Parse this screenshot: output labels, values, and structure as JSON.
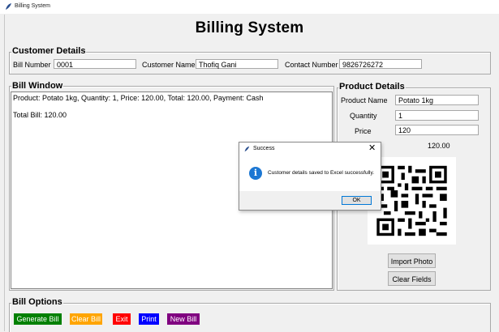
{
  "window": {
    "title": "Billing System"
  },
  "app_title": "Billing System",
  "customer_details": {
    "legend": "Customer Details",
    "bill_number_label": "Bill Number",
    "bill_number_value": "0001",
    "customer_name_label": "Customer Name",
    "customer_name_value": "Thofiq Gani",
    "contact_number_label": "Contact Number",
    "contact_number_value": "9826726272"
  },
  "bill_window": {
    "legend": "Bill Window",
    "line1": "Product: Potato 1kg, Quantity: 1, Price: 120.00, Total: 120.00, Payment: Cash",
    "line2": "Total Bill: 120.00"
  },
  "product_details": {
    "legend": "Product Details",
    "product_name_label": "Product Name",
    "product_name_value": "Potato 1kg",
    "quantity_label": "Quantity",
    "quantity_value": "1",
    "price_label": "Price",
    "price_value": "120",
    "total_value": "120.00",
    "import_photo_label": "Import Photo",
    "clear_fields_label": "Clear Fields"
  },
  "bill_options": {
    "legend": "Bill Options",
    "buttons": [
      {
        "label": "Generate Bill",
        "bg": "#008000",
        "fg": "#ffffff"
      },
      {
        "label": "Clear Bill",
        "bg": "#ffa500",
        "fg": "#ffffff"
      },
      {
        "label": "Exit",
        "bg": "#ff0000",
        "fg": "#ffffff"
      },
      {
        "label": "Print",
        "bg": "#0000ff",
        "fg": "#ffffff"
      },
      {
        "label": "New Bill",
        "bg": "#800080",
        "fg": "#ffffff"
      }
    ]
  },
  "dialog": {
    "title": "Success",
    "message": "Customer details saved to Excel successfully.",
    "ok_label": "OK",
    "icon": "info-icon",
    "close_icon": "close-icon"
  },
  "colors": {
    "dialog_accent": "#0078d7",
    "info_icon": "#1c77d3"
  }
}
